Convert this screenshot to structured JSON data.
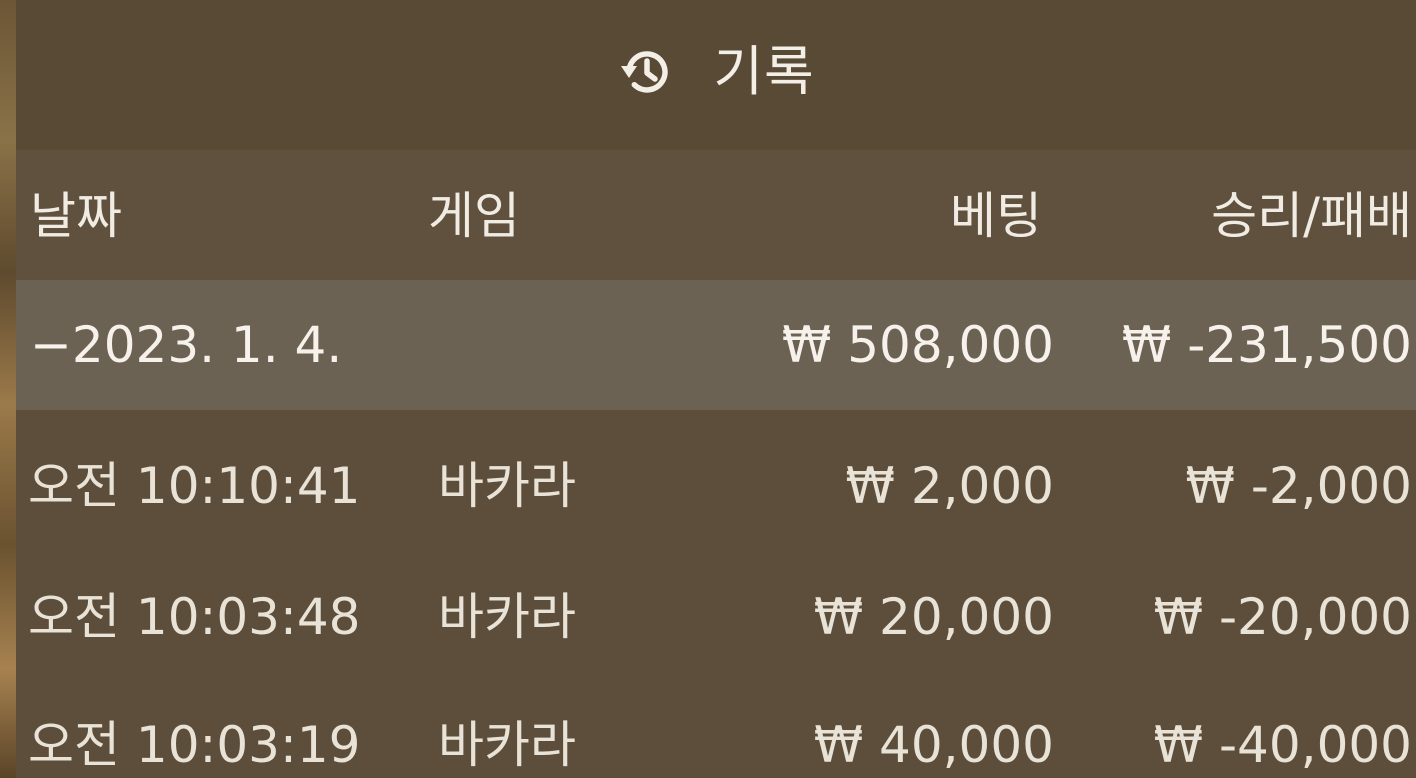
{
  "header": {
    "icon": "history-icon",
    "title": "기록"
  },
  "columns": {
    "date": "날짜",
    "game": "게임",
    "bet": "베팅",
    "result": "승리/패배"
  },
  "summary": {
    "date": "−2023. 1. 4.",
    "bet": "₩ 508,000",
    "result": "₩ -231,500"
  },
  "rows": [
    {
      "time": "오전 10:10:41",
      "game": "바카라",
      "bet": "₩ 2,000",
      "result": "₩ -2,000"
    },
    {
      "time": "오전 10:03:48",
      "game": "바카라",
      "bet": "₩ 20,000",
      "result": "₩ -20,000"
    },
    {
      "time": "오전 10:03:19",
      "game": "바카라",
      "bet": "₩ 40,000",
      "result": "₩ -40,000"
    }
  ]
}
